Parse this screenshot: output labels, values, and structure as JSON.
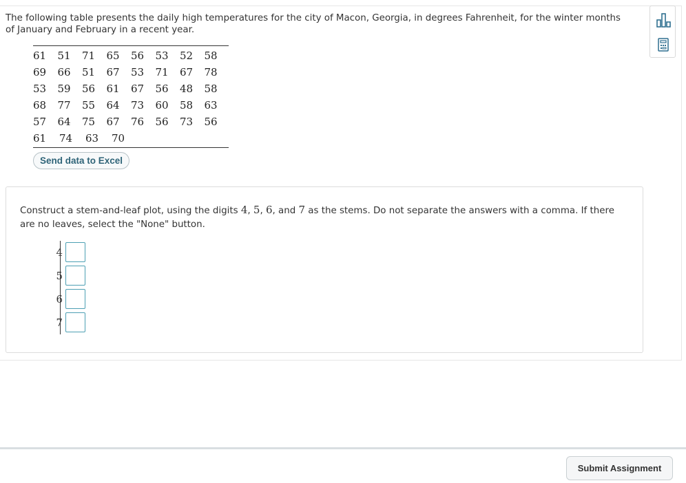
{
  "intro": {
    "text": "The following table presents the daily high temperatures for the city of Macon, Georgia, in degrees Fahrenheit, for the winter months of January and February in a recent year."
  },
  "table": {
    "rows": [
      [
        "61",
        "51",
        "71",
        "65",
        "56",
        "53",
        "52",
        "58"
      ],
      [
        "69",
        "66",
        "51",
        "67",
        "53",
        "71",
        "67",
        "78"
      ],
      [
        "53",
        "59",
        "56",
        "61",
        "67",
        "56",
        "48",
        "58"
      ],
      [
        "68",
        "77",
        "55",
        "64",
        "73",
        "60",
        "58",
        "63"
      ],
      [
        "57",
        "64",
        "75",
        "67",
        "76",
        "56",
        "73",
        "56"
      ],
      [
        "61",
        "74",
        "63",
        "70"
      ]
    ]
  },
  "excel_button": {
    "label": "Send data to Excel"
  },
  "side_tools": [
    {
      "icon": "bar-chart-icon",
      "color": "#2f6f8f"
    },
    {
      "icon": "calculator-icon",
      "color": "#2f6f8f"
    }
  ],
  "question": {
    "text_before": "Construct a stem-and-leaf plot, using the digits ",
    "stem_digits": [
      "4",
      "5",
      "6",
      "7"
    ],
    "sep_1": ", ",
    "sep_2": ", ",
    "sep_3": ", and ",
    "text_after": " as the stems. Do not separate the answers with a comma. If there are no leaves, select the \"None\" button."
  },
  "stem_plot": {
    "stems": [
      "4",
      "5",
      "6",
      "7"
    ],
    "leaves": [
      "",
      "",
      "",
      ""
    ]
  },
  "footer": {
    "submit_label": "Submit Assignment"
  },
  "colors": {
    "accent": "#2f6478",
    "input_border": "#4c9fb3"
  }
}
